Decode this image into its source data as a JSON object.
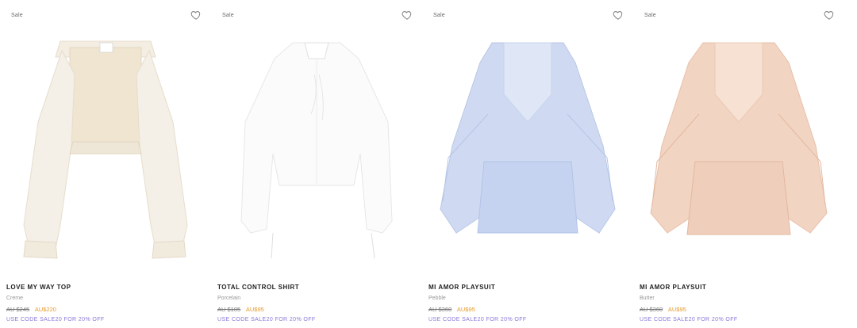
{
  "products": [
    {
      "badge": "Sale",
      "name": "LOVE MY WAY TOP",
      "color": "Creme",
      "old_price": "AU $245",
      "new_price": "AU$220",
      "promo": "USE CODE SALE20 FOR 20% OFF",
      "favorite_icon": "heart-outline-icon"
    },
    {
      "badge": "Sale",
      "name": "TOTAL CONTROL SHIRT",
      "color": "Porcelain",
      "old_price": "AU $105",
      "new_price": "AU$95",
      "promo": "USE CODE SALE20 FOR 20% OFF",
      "favorite_icon": "heart-outline-icon"
    },
    {
      "badge": "Sale",
      "name": "MI AMOR PLAYSUIT",
      "color": "Pebble",
      "old_price": "AU $360",
      "new_price": "AU$95",
      "promo": "USE CODE SALE20 FOR 20% OFF",
      "favorite_icon": "heart-outline-icon"
    },
    {
      "badge": "Sale",
      "name": "MI AMOR PLAYSUIT",
      "color": "Butter",
      "old_price": "AU $360",
      "new_price": "AU$95",
      "promo": "USE CODE SALE20 FOR 20% OFF",
      "favorite_icon": "heart-outline-icon"
    }
  ],
  "colors": {
    "sale_price": "#e69a2c",
    "promo": "#8b77d8"
  }
}
